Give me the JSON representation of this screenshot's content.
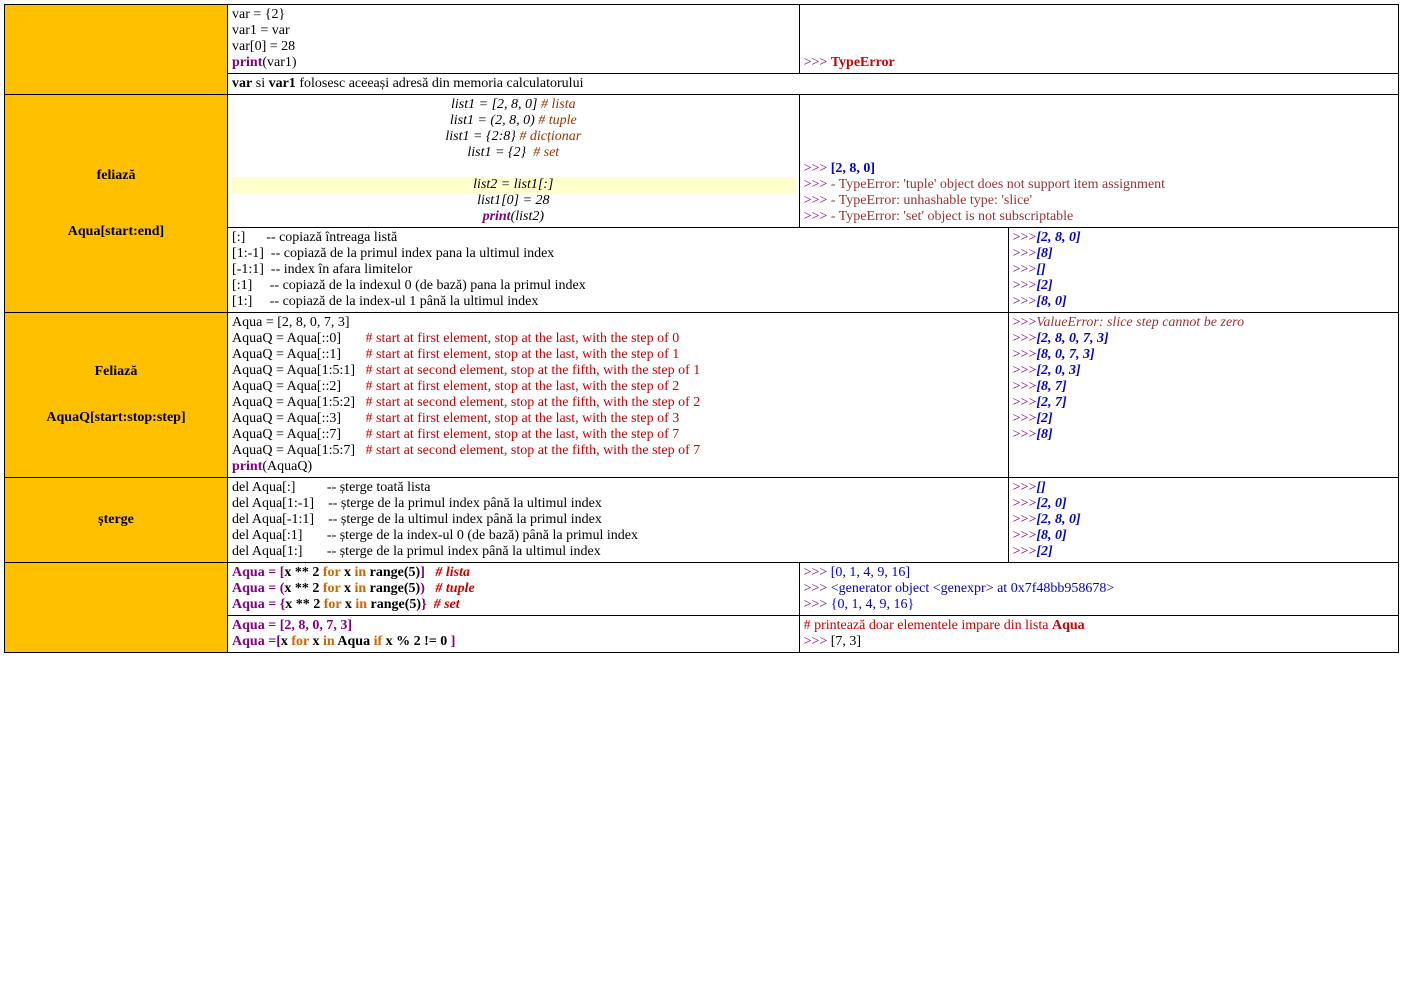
{
  "r1": {
    "hdr": "",
    "code": [
      {
        "segs": [
          {
            "t": "var = {2}"
          }
        ]
      },
      {
        "segs": [
          {
            "t": "var1 = var"
          }
        ]
      },
      {
        "segs": [
          {
            "t": "var[0] = 28"
          }
        ]
      },
      {
        "segs": [
          {
            "t": "print",
            "cls": "kw-purple"
          },
          {
            "t": "(var1)"
          }
        ]
      }
    ],
    "out": [
      {
        "segs": [
          {
            "t": ">>> ",
            "cls": "prompt"
          },
          {
            "t": "TypeError",
            "cls": "out-red-bold"
          }
        ]
      }
    ],
    "note": [
      {
        "segs": [
          {
            "t": "var",
            "cls": "bold"
          },
          {
            "t": " si "
          },
          {
            "t": "var1",
            "cls": "bold"
          },
          {
            "t": " folosesc aceeași adresă din memoria calculatorului"
          }
        ]
      }
    ]
  },
  "r2": {
    "hdr1": "feliază",
    "hdr2": "Aqua[start:end]",
    "code": [
      {
        "cls": "center italic",
        "segs": [
          {
            "t": "list1 = [2, 8, 0] "
          },
          {
            "t": "# lista",
            "cls": "comment-maroon"
          }
        ]
      },
      {
        "cls": "center italic",
        "segs": [
          {
            "t": "list1 = (2, 8, 0) "
          },
          {
            "t": "# tuple",
            "cls": "comment-maroon"
          }
        ]
      },
      {
        "cls": "center italic",
        "segs": [
          {
            "t": "list1 = {2:8} "
          },
          {
            "t": "# dicționar",
            "cls": "comment-maroon"
          }
        ]
      },
      {
        "cls": "center italic",
        "segs": [
          {
            "t": "list1 = {2}  "
          },
          {
            "t": "# set",
            "cls": "comment-maroon"
          }
        ]
      },
      {
        "cls": "center italic",
        "segs": [
          {
            "t": " "
          }
        ]
      },
      {
        "cls": "center italic hl",
        "segs": [
          {
            "t": "list2 = list1[:]"
          }
        ]
      },
      {
        "cls": "center italic",
        "segs": [
          {
            "t": "list1[0] = 28"
          }
        ]
      },
      {
        "cls": "center italic",
        "segs": [
          {
            "t": "print",
            "cls": "kw-purple"
          },
          {
            "t": "(list2)"
          }
        ]
      }
    ],
    "out": [
      {
        "segs": [
          {
            "t": ">>> ",
            "cls": "prompt"
          },
          {
            "t": "[2, 8, 0]",
            "cls": "txt-blue bold"
          }
        ]
      },
      {
        "segs": [
          {
            "t": ">>> ",
            "cls": "prompt"
          },
          {
            "t": "- TypeError: 'tuple' object does not support item assignment",
            "cls": "err"
          }
        ]
      },
      {
        "segs": [
          {
            "t": ">>> ",
            "cls": "prompt"
          },
          {
            "t": "- TypeError: unhashable type: 'slice'",
            "cls": "err"
          }
        ]
      },
      {
        "segs": [
          {
            "t": ">>> ",
            "cls": "prompt"
          },
          {
            "t": "- TypeError: 'set' object is not subscriptable",
            "cls": "err"
          }
        ]
      }
    ],
    "slice_code": [
      {
        "segs": [
          {
            "t": "[:]      -- copiază întreaga listă"
          }
        ]
      },
      {
        "segs": [
          {
            "t": "[1:-1]  -- copiază de la primul index pana la ultimul index"
          }
        ]
      },
      {
        "segs": [
          {
            "t": "[-1:1]  -- index în afara limitelor"
          }
        ]
      },
      {
        "segs": [
          {
            "t": "[:1]     -- copiază de la indexul 0 (de bază) pana la primul index"
          }
        ]
      },
      {
        "segs": [
          {
            "t": "[1:]     -- copiază de la index-ul 1 până la ultimul index"
          }
        ]
      }
    ],
    "slice_out": [
      {
        "segs": [
          {
            "t": ">>>",
            "cls": "prompt"
          },
          {
            "t": "[2, 8, 0]",
            "cls": "out-blue"
          }
        ]
      },
      {
        "segs": [
          {
            "t": ">>>",
            "cls": "prompt"
          },
          {
            "t": "[8]",
            "cls": "out-blue"
          }
        ]
      },
      {
        "segs": [
          {
            "t": ">>>",
            "cls": "prompt"
          },
          {
            "t": "[]",
            "cls": "out-blue"
          }
        ]
      },
      {
        "segs": [
          {
            "t": ">>>",
            "cls": "prompt"
          },
          {
            "t": "[2]",
            "cls": "out-blue"
          }
        ]
      },
      {
        "segs": [
          {
            "t": ">>>",
            "cls": "prompt"
          },
          {
            "t": "[8, 0]",
            "cls": "out-blue"
          }
        ]
      }
    ]
  },
  "r3": {
    "hdr1": "Feliază",
    "hdr2": "AquaQ[start:stop:step]",
    "code": [
      {
        "segs": [
          {
            "t": "Aqua = [2, 8, 0, 7, 3]"
          }
        ]
      },
      {
        "segs": [
          {
            "t": "AquaQ = Aqua[::0]       "
          },
          {
            "t": "# start at first element, stop at the last, with the step of 0",
            "cls": "comment-red"
          }
        ]
      },
      {
        "segs": [
          {
            "t": "AquaQ = Aqua[::1]       "
          },
          {
            "t": "# start at first element, stop at the last, with the step of 1",
            "cls": "comment-red"
          }
        ]
      },
      {
        "segs": [
          {
            "t": "AquaQ = Aqua[1:5:1]   "
          },
          {
            "t": "# start at second element, stop at the fifth, with the step of 1",
            "cls": "comment-red"
          }
        ]
      },
      {
        "segs": [
          {
            "t": "AquaQ = Aqua[::2]       "
          },
          {
            "t": "# start at first element, stop at the last, with the step of 2",
            "cls": "comment-red"
          }
        ]
      },
      {
        "segs": [
          {
            "t": "AquaQ = Aqua[1:5:2]   "
          },
          {
            "t": "# start at second element, stop at the fifth, with the step of 2",
            "cls": "comment-red"
          }
        ]
      },
      {
        "segs": [
          {
            "t": "AquaQ = Aqua[::3]       "
          },
          {
            "t": "# start at first element, stop at the last, with the step of 3",
            "cls": "comment-red"
          }
        ]
      },
      {
        "segs": [
          {
            "t": "AquaQ = Aqua[::7]       "
          },
          {
            "t": "# start at first element, stop at the last, with the step of 7",
            "cls": "comment-red"
          }
        ]
      },
      {
        "segs": [
          {
            "t": "AquaQ = Aqua[1:5:7]   "
          },
          {
            "t": "# start at second element, stop at the fifth, with the step of 7",
            "cls": "comment-red"
          }
        ]
      },
      {
        "segs": [
          {
            "t": "print",
            "cls": "kw-purple"
          },
          {
            "t": "(AquaQ)"
          }
        ]
      }
    ],
    "out": [
      {
        "segs": [
          {
            "t": ">>>",
            "cls": "prompt"
          },
          {
            "t": "ValueError: slice step cannot be zero",
            "cls": "maroon-italic"
          }
        ]
      },
      {
        "segs": [
          {
            "t": ">>>",
            "cls": "prompt"
          },
          {
            "t": "[2, 8, 0, 7, 3]",
            "cls": "out-blue"
          }
        ]
      },
      {
        "segs": [
          {
            "t": ">>>",
            "cls": "prompt"
          },
          {
            "t": "[8, 0, 7, 3]",
            "cls": "out-blue"
          }
        ]
      },
      {
        "segs": [
          {
            "t": ">>>",
            "cls": "prompt"
          },
          {
            "t": "[2, 0, 3]",
            "cls": "out-blue"
          }
        ]
      },
      {
        "segs": [
          {
            "t": ">>>",
            "cls": "prompt"
          },
          {
            "t": "[8, 7]",
            "cls": "out-blue"
          }
        ]
      },
      {
        "segs": [
          {
            "t": ">>>",
            "cls": "prompt"
          },
          {
            "t": "[2, 7]",
            "cls": "out-blue"
          }
        ]
      },
      {
        "segs": [
          {
            "t": ">>>",
            "cls": "prompt"
          },
          {
            "t": "[2]",
            "cls": "out-blue"
          }
        ]
      },
      {
        "segs": [
          {
            "t": ">>>",
            "cls": "prompt"
          },
          {
            "t": "[8]",
            "cls": "out-blue"
          }
        ]
      }
    ]
  },
  "r4": {
    "hdr": "șterge",
    "code": [
      {
        "segs": [
          {
            "t": "del Aqua[:]         -- șterge toată lista"
          }
        ]
      },
      {
        "segs": [
          {
            "t": "del Aqua[1:-1]    -- șterge de la primul index până la ultimul index"
          }
        ]
      },
      {
        "segs": [
          {
            "t": "del Aqua[-1:1]    -- șterge de la ultimul index până la primul index"
          }
        ]
      },
      {
        "segs": [
          {
            "t": "del Aqua[:1]       -- șterge de la index-ul 0 (de bază) până la primul index"
          }
        ]
      },
      {
        "segs": [
          {
            "t": "del Aqua[1:]       -- șterge de la primul index până la ultimul index"
          }
        ]
      }
    ],
    "out": [
      {
        "segs": [
          {
            "t": ">>>",
            "cls": "prompt"
          },
          {
            "t": "[]",
            "cls": "out-blue"
          }
        ]
      },
      {
        "segs": [
          {
            "t": ">>>",
            "cls": "prompt"
          },
          {
            "t": "[2, 0]",
            "cls": "out-blue"
          }
        ]
      },
      {
        "segs": [
          {
            "t": ">>>",
            "cls": "prompt"
          },
          {
            "t": "[2, 8, 0]",
            "cls": "out-blue"
          }
        ]
      },
      {
        "segs": [
          {
            "t": ">>>",
            "cls": "prompt"
          },
          {
            "t": "[8, 0]",
            "cls": "out-blue"
          }
        ]
      },
      {
        "segs": [
          {
            "t": ">>>",
            "cls": "prompt"
          },
          {
            "t": "[2]",
            "cls": "out-blue"
          }
        ]
      }
    ]
  },
  "r5": {
    "hdr": "",
    "code": [
      {
        "segs": [
          {
            "t": "Aqua = [",
            "cls": "kw-purple"
          },
          {
            "t": "x ** 2 ",
            "cls": "bold"
          },
          {
            "t": "for",
            "cls": "kw-orange"
          },
          {
            "t": " x ",
            "cls": "bold"
          },
          {
            "t": "in",
            "cls": "kw-orange"
          },
          {
            "t": " range(5)",
            "cls": "bold"
          },
          {
            "t": "]",
            "cls": "kw-purple"
          },
          {
            "t": "   "
          },
          {
            "t": "# lista",
            "cls": "comment-red italic bold"
          }
        ]
      },
      {
        "segs": [
          {
            "t": "Aqua = (",
            "cls": "kw-purple"
          },
          {
            "t": "x ** 2 ",
            "cls": "bold"
          },
          {
            "t": "for",
            "cls": "kw-orange"
          },
          {
            "t": " x ",
            "cls": "bold"
          },
          {
            "t": "in",
            "cls": "kw-orange"
          },
          {
            "t": " range(5)",
            "cls": "bold"
          },
          {
            "t": ")",
            "cls": "kw-purple"
          },
          {
            "t": "   "
          },
          {
            "t": "# tuple",
            "cls": "comment-red italic bold"
          }
        ]
      },
      {
        "segs": [
          {
            "t": "Aqua = {",
            "cls": "kw-purple"
          },
          {
            "t": "x ** 2 ",
            "cls": "bold"
          },
          {
            "t": "for",
            "cls": "kw-orange"
          },
          {
            "t": " x ",
            "cls": "bold"
          },
          {
            "t": "in",
            "cls": "kw-orange"
          },
          {
            "t": " range(5)",
            "cls": "bold"
          },
          {
            "t": "}",
            "cls": "kw-purple"
          },
          {
            "t": "  "
          },
          {
            "t": "# set",
            "cls": "comment-red italic bold"
          }
        ]
      }
    ],
    "out": [
      {
        "segs": [
          {
            "t": ">>> ",
            "cls": "prompt"
          },
          {
            "t": "[0, 1, 4, 9, 16]",
            "cls": "txt-blue"
          }
        ]
      },
      {
        "segs": [
          {
            "t": ">>> ",
            "cls": "prompt"
          },
          {
            "t": "<generator object <genexpr> at 0x7f48bb958678>",
            "cls": "txt-blue"
          }
        ]
      },
      {
        "segs": [
          {
            "t": ">>> ",
            "cls": "prompt"
          },
          {
            "t": "{0, 1, 4, 9, 16}",
            "cls": "txt-blue"
          }
        ]
      }
    ],
    "code2": [
      {
        "segs": [
          {
            "t": "Aqua = [2, 8, 0, 7, 3]",
            "cls": "kw-purple"
          }
        ]
      },
      {
        "segs": [
          {
            "t": "Aqua =[",
            "cls": "kw-purple"
          },
          {
            "t": "x ",
            "cls": "bold"
          },
          {
            "t": "for",
            "cls": "kw-orange"
          },
          {
            "t": " x ",
            "cls": "bold"
          },
          {
            "t": "in",
            "cls": "kw-orange"
          },
          {
            "t": " Aqua ",
            "cls": "bold"
          },
          {
            "t": "if",
            "cls": "kw-orange"
          },
          {
            "t": " x % 2 != 0 ",
            "cls": "bold"
          },
          {
            "t": "]",
            "cls": "kw-purple"
          }
        ]
      }
    ],
    "out2": [
      {
        "segs": [
          {
            "t": "# ",
            "cls": "comment-red"
          },
          {
            "t": "printează doar elementele impare din lista ",
            "cls": "comment-red"
          },
          {
            "t": "Aqua",
            "cls": "out-red-bold"
          }
        ]
      },
      {
        "segs": [
          {
            "t": ">>> ",
            "cls": "prompt"
          },
          {
            "t": "[7, 3]"
          }
        ]
      }
    ]
  }
}
